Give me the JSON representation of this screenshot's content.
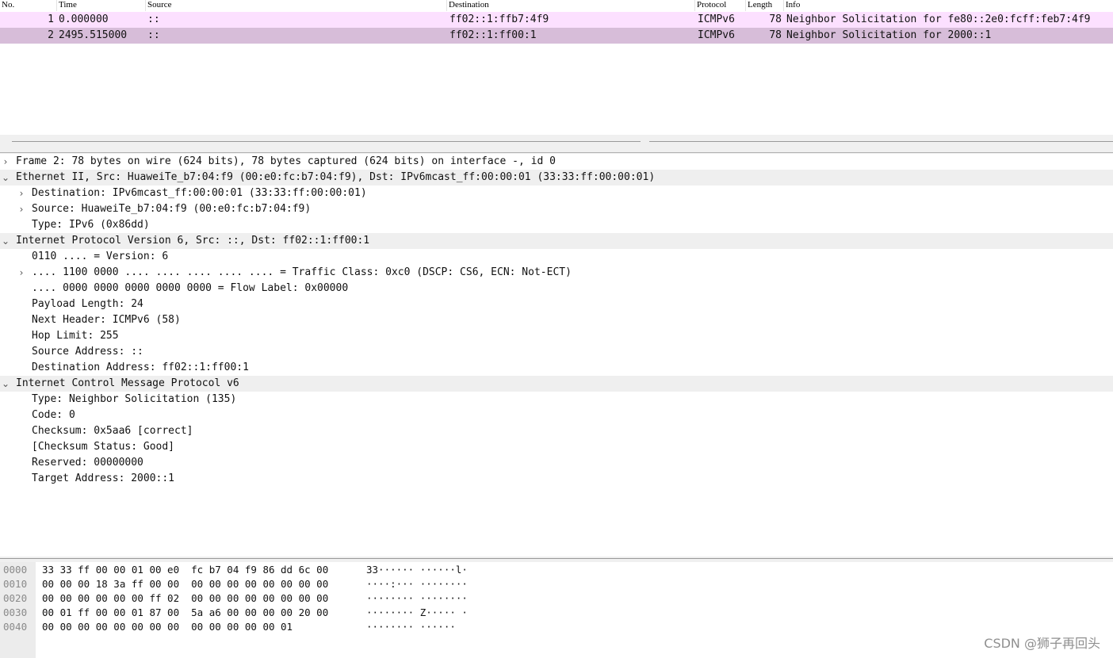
{
  "packet_list": {
    "columns": [
      "No.",
      "Time",
      "Source",
      "Destination",
      "Protocol",
      "Length",
      "Info"
    ],
    "rows": [
      {
        "no": "1",
        "time": "0.000000",
        "source": "::",
        "destination": "ff02::1:ffb7:4f9",
        "protocol": "ICMPv6",
        "length": "78",
        "info": "Neighbor Solicitation for fe80::2e0:fcff:feb7:4f9"
      },
      {
        "no": "2",
        "time": "2495.515000",
        "source": "::",
        "destination": "ff02::1:ff00:1",
        "protocol": "ICMPv6",
        "length": "78",
        "info": "Neighbor Solicitation for 2000::1"
      }
    ]
  },
  "details": [
    {
      "text": "Frame 2: 78 bytes on wire (624 bits), 78 bytes captured (624 bits) on interface -, id 0",
      "arrow": "›",
      "level": 0
    },
    {
      "text": "Ethernet II, Src: HuaweiTe_b7:04:f9 (00:e0:fc:b7:04:f9), Dst: IPv6mcast_ff:00:00:01 (33:33:ff:00:00:01)",
      "arrow": "⌄",
      "level": 0
    },
    {
      "text": "Destination: IPv6mcast_ff:00:00:01 (33:33:ff:00:00:01)",
      "arrow": "›",
      "level": 1
    },
    {
      "text": "Source: HuaweiTe_b7:04:f9 (00:e0:fc:b7:04:f9)",
      "arrow": "›",
      "level": 1
    },
    {
      "text": "Type: IPv6 (0x86dd)",
      "arrow": "",
      "level": 1
    },
    {
      "text": "Internet Protocol Version 6, Src: ::, Dst: ff02::1:ff00:1",
      "arrow": "⌄",
      "level": 0
    },
    {
      "text": "0110 .... = Version: 6",
      "arrow": "",
      "level": 1
    },
    {
      "text": ".... 1100 0000 .... .... .... .... .... = Traffic Class: 0xc0 (DSCP: CS6, ECN: Not-ECT)",
      "arrow": "›",
      "level": 1
    },
    {
      "text": ".... 0000 0000 0000 0000 0000 = Flow Label: 0x00000",
      "arrow": "",
      "level": 1
    },
    {
      "text": "Payload Length: 24",
      "arrow": "",
      "level": 1
    },
    {
      "text": "Next Header: ICMPv6 (58)",
      "arrow": "",
      "level": 1
    },
    {
      "text": "Hop Limit: 255",
      "arrow": "",
      "level": 1
    },
    {
      "text": "Source Address: ::",
      "arrow": "",
      "level": 1
    },
    {
      "text": "Destination Address: ff02::1:ff00:1",
      "arrow": "",
      "level": 1
    },
    {
      "text": "Internet Control Message Protocol v6",
      "arrow": "⌄",
      "level": 0
    },
    {
      "text": "Type: Neighbor Solicitation (135)",
      "arrow": "",
      "level": 1
    },
    {
      "text": "Code: 0",
      "arrow": "",
      "level": 1
    },
    {
      "text": "Checksum: 0x5aa6 [correct]",
      "arrow": "",
      "level": 1
    },
    {
      "text": "[Checksum Status: Good]",
      "arrow": "",
      "level": 1
    },
    {
      "text": "Reserved: 00000000",
      "arrow": "",
      "level": 1
    },
    {
      "text": "Target Address: 2000::1",
      "arrow": "",
      "level": 1
    }
  ],
  "bytes": [
    {
      "offset": "0000",
      "hex": "33 33 ff 00 00 01 00 e0  fc b7 04 f9 86 dd 6c 00",
      "ascii": "33······ ······l·"
    },
    {
      "offset": "0010",
      "hex": "00 00 00 18 3a ff 00 00  00 00 00 00 00 00 00 00",
      "ascii": "····:··· ········"
    },
    {
      "offset": "0020",
      "hex": "00 00 00 00 00 00 ff 02  00 00 00 00 00 00 00 00",
      "ascii": "········ ········"
    },
    {
      "offset": "0030",
      "hex": "00 01 ff 00 00 01 87 00  5a a6 00 00 00 00 20 00",
      "ascii": "········ Z····· ·"
    },
    {
      "offset": "0040",
      "hex": "00 00 00 00 00 00 00 00  00 00 00 00 00 01",
      "ascii": "········ ······"
    }
  ],
  "watermark": "CSDN @狮子再回头",
  "colors": {
    "row1_bg": "#fce0ff",
    "row2_bg": "#d7bdd9",
    "detail_highlight": "#efefef"
  }
}
